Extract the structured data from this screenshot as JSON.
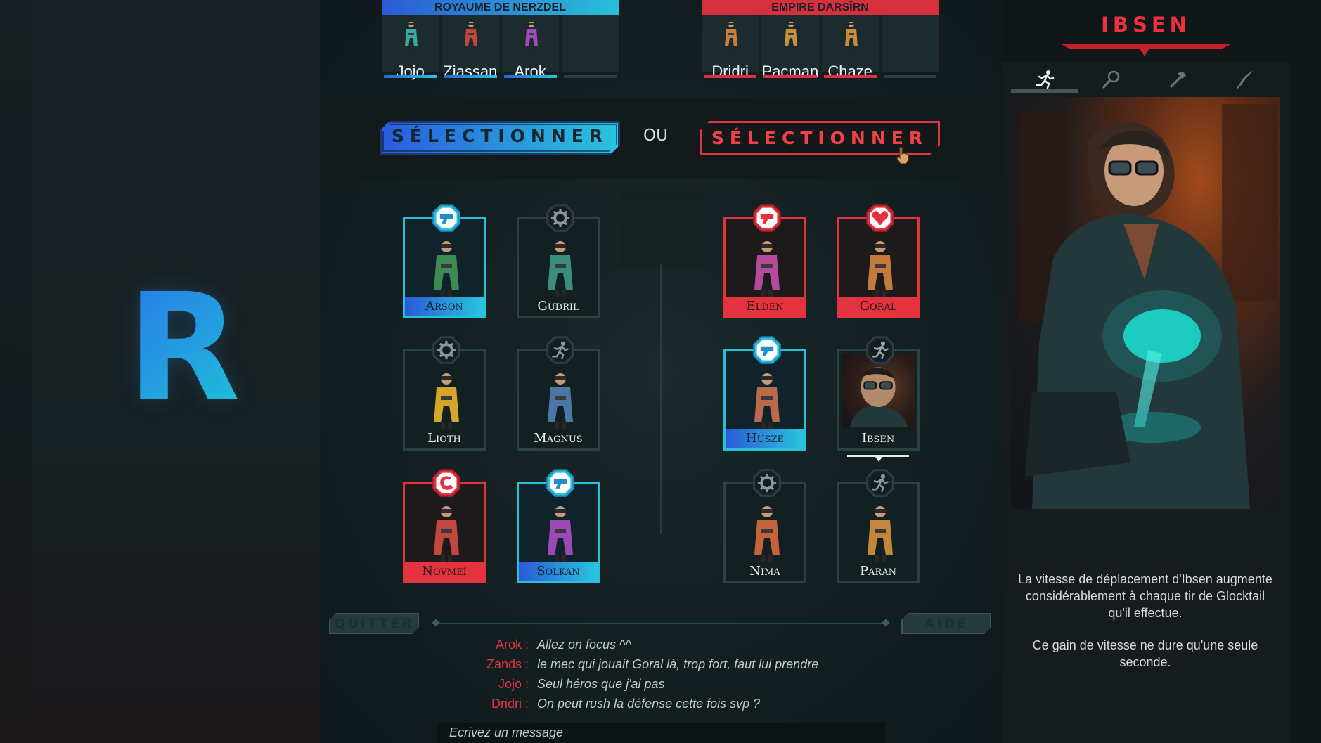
{
  "big_letter": "R",
  "team_blue": {
    "name": "ROYAUME DE NERZDEL",
    "color": "#2ac0d6",
    "players": [
      {
        "name": "Jojo",
        "color": "#3aa7a0"
      },
      {
        "name": "Ziassan",
        "color": "#c0463e"
      },
      {
        "name": "Arok",
        "color": "#a24ac0"
      },
      {
        "name": "",
        "color": ""
      }
    ]
  },
  "team_red": {
    "name": "EMPIRE DARSÎRN",
    "color": "#d6303d",
    "players": [
      {
        "name": "Dridri",
        "color": "#c77d3b"
      },
      {
        "name": "Pacman",
        "color": "#c9923a"
      },
      {
        "name": "Chaze",
        "color": "#c98a3a"
      },
      {
        "name": "",
        "color": ""
      }
    ]
  },
  "select_blue_label": "SÉLECTIONNER",
  "select_red_label": "SÉLECTIONNER",
  "or_label": "OU",
  "heroes": [
    {
      "name": "Arson",
      "state": "blue",
      "icon": "gun-icon",
      "coat": "#3f8a52"
    },
    {
      "name": "Gudril",
      "state": "none",
      "icon": "gear-icon",
      "coat": "#3a8c7c"
    },
    {
      "name": "Lioth",
      "state": "none",
      "icon": "gear-icon",
      "coat": "#d4a62a"
    },
    {
      "name": "Magnus",
      "state": "none",
      "icon": "runner-icon",
      "coat": "#4d76a8"
    },
    {
      "name": "Novmeï",
      "state": "red",
      "icon": "magnet-icon",
      "coat": "#c2473c"
    },
    {
      "name": "Solkan",
      "state": "blue",
      "icon": "gun-icon",
      "coat": "#9c4ab8"
    },
    {
      "name": "Elden",
      "state": "red",
      "icon": "gun-icon",
      "coat": "#b44a9c"
    },
    {
      "name": "Goral",
      "state": "red",
      "icon": "heart-icon",
      "coat": "#c47a38"
    },
    {
      "name": "Husze",
      "state": "blue",
      "icon": "gun-icon",
      "coat": "#b86a4a"
    },
    {
      "name": "Ibsen",
      "state": "hover",
      "icon": "runner-icon",
      "coat": "#8a5a3a"
    },
    {
      "name": "Nima",
      "state": "none",
      "icon": "gear-icon",
      "coat": "#c4643a"
    },
    {
      "name": "Paran",
      "state": "none",
      "icon": "runner-icon",
      "coat": "#c4863a"
    }
  ],
  "buttons": {
    "quit": "QUITTER",
    "help": "AIDE"
  },
  "chat": [
    {
      "who": "Arok :",
      "msg": "Allez on focus ^^"
    },
    {
      "who": "Zands :",
      "msg": "le mec qui jouait Goral là, trop fort, faut lui prendre"
    },
    {
      "who": "Jojo :",
      "msg": "Seul héros que j'ai pas"
    },
    {
      "who": "Dridri :",
      "msg": "On peut rush la défense cette fois svp ?"
    }
  ],
  "chat_placeholder": "Ecrivez un message",
  "detail": {
    "hero_name": "IBSEN",
    "tabs": [
      "runner-icon",
      "magnifier-icon",
      "hammer-icon",
      "quill-icon"
    ],
    "description": [
      "La vitesse de déplacement d'Ibsen augmente considérablement à chaque tir de Glocktail qu'il effectue.",
      "Ce gain de vitesse ne dure qu'une seule seconde."
    ]
  },
  "colors": {
    "blue_accent": "#28c6dc",
    "red_accent": "#e5323f"
  }
}
